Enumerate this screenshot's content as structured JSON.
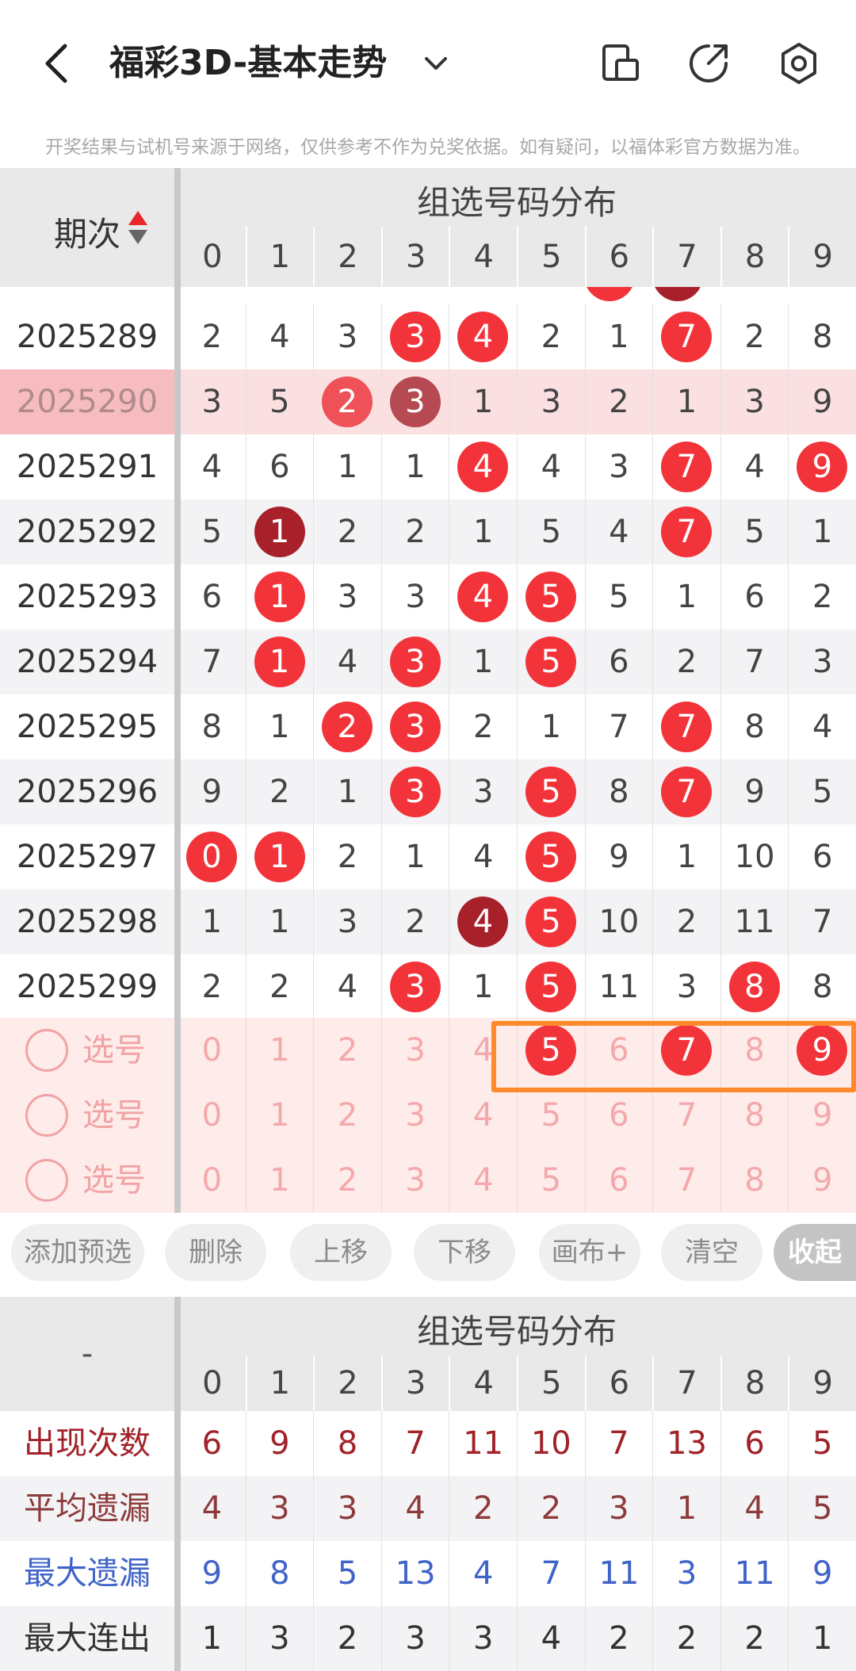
{
  "header": {
    "title": "福彩3D-基本走势",
    "notice": "开奖结果与试机号来源于网络，仅供参考不作为兑奖依据。如有疑问，以福体彩官方数据为准。"
  },
  "trend": {
    "period_header": "期次",
    "dist_header": "组选号码分布",
    "digits": [
      "0",
      "1",
      "2",
      "3",
      "4",
      "5",
      "6",
      "7",
      "8",
      "9"
    ],
    "rows": [
      {
        "period": "2025289",
        "cells": [
          "2",
          "4",
          "3",
          "3",
          "4",
          "2",
          "1",
          "7",
          "2",
          "8"
        ],
        "balls": [
          3,
          4,
          7
        ],
        "style": "normal"
      },
      {
        "period": "2025290",
        "cells": [
          "3",
          "5",
          "2",
          "3",
          "1",
          "3",
          "2",
          "1",
          "3",
          "9"
        ],
        "balls": [
          2,
          3
        ],
        "style": "highlight"
      },
      {
        "period": "2025291",
        "cells": [
          "4",
          "6",
          "1",
          "1",
          "4",
          "4",
          "3",
          "7",
          "4",
          "9"
        ],
        "balls": [
          4,
          7,
          9
        ],
        "style": "normal"
      },
      {
        "period": "2025292",
        "cells": [
          "5",
          "1",
          "2",
          "2",
          "1",
          "5",
          "4",
          "7",
          "5",
          "1"
        ],
        "balls": [
          1,
          7
        ],
        "style": "alt"
      },
      {
        "period": "2025293",
        "cells": [
          "6",
          "1",
          "3",
          "3",
          "4",
          "5",
          "5",
          "1",
          "6",
          "2"
        ],
        "balls": [
          1,
          4,
          5
        ],
        "style": "normal"
      },
      {
        "period": "2025294",
        "cells": [
          "7",
          "1",
          "4",
          "3",
          "1",
          "5",
          "6",
          "2",
          "7",
          "3"
        ],
        "balls": [
          1,
          3,
          5
        ],
        "style": "alt"
      },
      {
        "period": "2025295",
        "cells": [
          "8",
          "1",
          "2",
          "3",
          "2",
          "1",
          "7",
          "7",
          "8",
          "4"
        ],
        "balls": [
          2,
          3,
          7
        ],
        "style": "normal"
      },
      {
        "period": "2025296",
        "cells": [
          "9",
          "2",
          "1",
          "3",
          "3",
          "5",
          "8",
          "7",
          "9",
          "5"
        ],
        "balls": [
          3,
          5,
          7
        ],
        "style": "alt"
      },
      {
        "period": "2025297",
        "cells": [
          "0",
          "1",
          "2",
          "1",
          "4",
          "5",
          "9",
          "1",
          "10",
          "6"
        ],
        "balls": [
          0,
          1,
          5
        ],
        "style": "normal"
      },
      {
        "period": "2025298",
        "cells": [
          "1",
          "1",
          "3",
          "2",
          "4",
          "5",
          "10",
          "2",
          "11",
          "7"
        ],
        "balls": [
          4,
          5
        ],
        "style": "alt"
      },
      {
        "period": "2025299",
        "cells": [
          "2",
          "2",
          "4",
          "3",
          "1",
          "5",
          "11",
          "3",
          "8",
          "8"
        ],
        "balls": [
          3,
          5,
          8
        ],
        "style": "normal"
      }
    ],
    "pick_label": "选号",
    "picks": [
      {
        "selected": [
          5,
          7,
          9
        ]
      },
      {
        "selected": []
      },
      {
        "selected": []
      }
    ]
  },
  "actions": [
    "添加预选",
    "删除",
    "上移",
    "下移",
    "画布+",
    "清空",
    "收起"
  ],
  "stats": {
    "period_header": "-",
    "dist_header": "组选号码分布",
    "rows": [
      {
        "label": "出现次数",
        "values": [
          "6",
          "9",
          "8",
          "7",
          "11",
          "10",
          "7",
          "13",
          "6",
          "5"
        ],
        "color": "#a12229"
      },
      {
        "label": "平均遗漏",
        "values": [
          "4",
          "3",
          "3",
          "4",
          "2",
          "2",
          "3",
          "1",
          "4",
          "5"
        ],
        "color": "#8d3a3a"
      },
      {
        "label": "最大遗漏",
        "values": [
          "9",
          "8",
          "5",
          "13",
          "4",
          "7",
          "11",
          "3",
          "11",
          "9"
        ],
        "color": "#3f63c8"
      },
      {
        "label": "最大连出",
        "values": [
          "1",
          "3",
          "2",
          "3",
          "3",
          "4",
          "2",
          "2",
          "2",
          "1"
        ],
        "color": "#333333"
      }
    ]
  }
}
